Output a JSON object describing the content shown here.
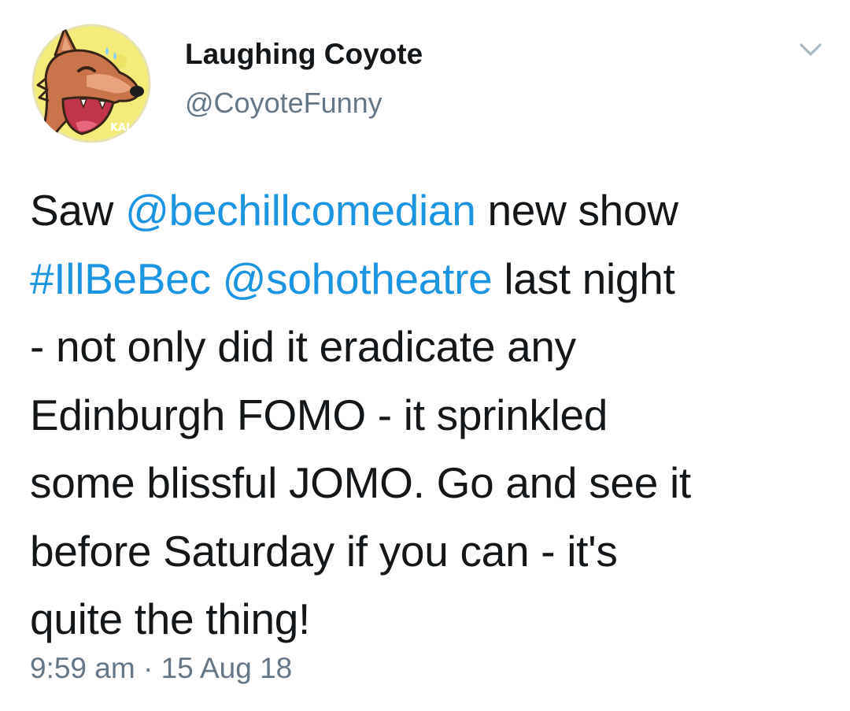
{
  "author": {
    "name": "Laughing Coyote",
    "handle": "@CoyoteFunny",
    "avatar_icon": "laughing-coyote-avatar",
    "avatar_lettering": "KAL"
  },
  "menu": {
    "icon": "chevron-down-icon"
  },
  "tweet": {
    "lines": [
      [
        {
          "text": "Saw ",
          "type": "text"
        },
        {
          "text": "@bechillcomedian",
          "type": "mention"
        },
        {
          "text": " new show",
          "type": "text"
        }
      ],
      [
        {
          "text": "#IllBeBec",
          "type": "hashtag"
        },
        {
          "text": " ",
          "type": "text"
        },
        {
          "text": "@sohotheatre",
          "type": "mention"
        },
        {
          "text": " last night",
          "type": "text"
        }
      ],
      [
        {
          "text": "- not only did it eradicate any",
          "type": "text"
        }
      ],
      [
        {
          "text": "Edinburgh FOMO - it sprinkled",
          "type": "text"
        }
      ],
      [
        {
          "text": "some blissful JOMO. Go and see it",
          "type": "text"
        }
      ],
      [
        {
          "text": "before Saturday if you can - it's",
          "type": "text"
        }
      ],
      [
        {
          "text": "quite the thing!",
          "type": "text"
        }
      ]
    ]
  },
  "meta": {
    "time": "9:59 am",
    "separator": "·",
    "date": "15 Aug 18"
  },
  "colors": {
    "link": "#1b95e0",
    "secondary": "#657786",
    "text": "#14171a",
    "avatar_bg": "#f3ec7a"
  }
}
